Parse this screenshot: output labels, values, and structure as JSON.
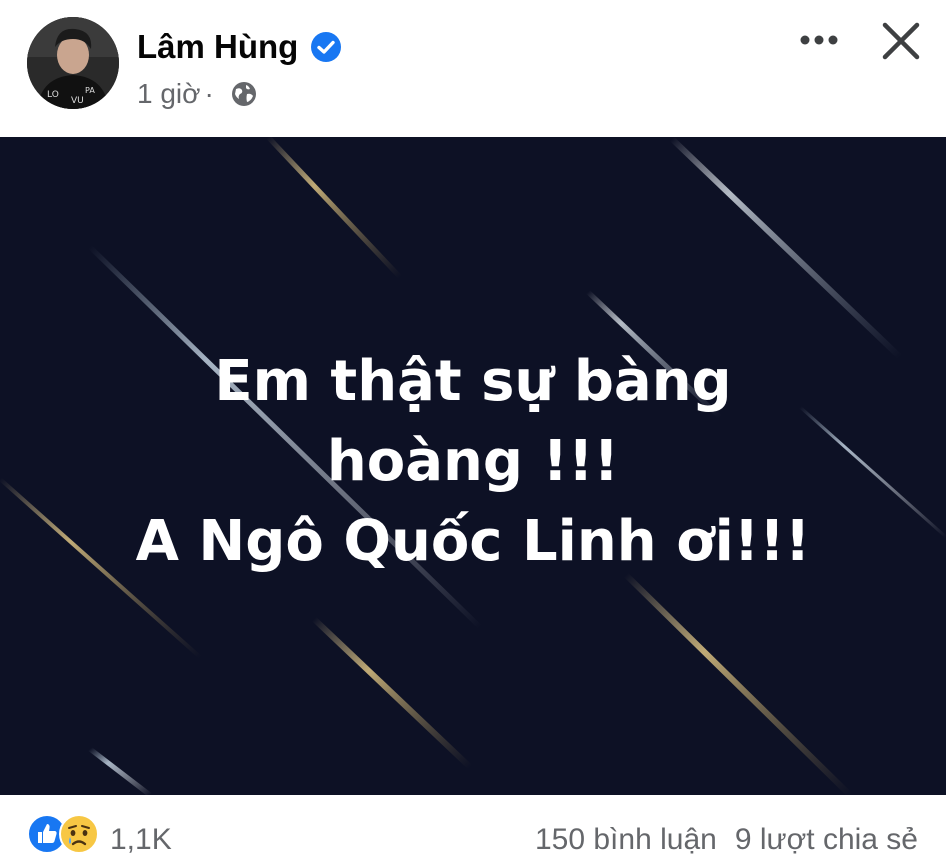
{
  "header": {
    "author_name": "Lâm Hùng",
    "verified": true,
    "timestamp": "1 giờ",
    "separator": "·",
    "privacy_icon": "globe-icon",
    "more_icon": "more-horizontal-icon",
    "close_icon": "close-icon"
  },
  "post_image": {
    "lines": [
      "Em thật sự bàng",
      "hoàng !!!",
      "A Ngô Quốc Linh ơi!!!"
    ]
  },
  "footer": {
    "reaction_icons": [
      "like-icon",
      "sad-icon"
    ],
    "reaction_count": "1,1K",
    "comments": "150 bình luận",
    "shares": "9 lượt chia sẻ"
  },
  "colors": {
    "text_primary": "#050505",
    "text_secondary": "#65676b",
    "verified_blue": "#1877f2",
    "image_background": "#0d1125"
  }
}
